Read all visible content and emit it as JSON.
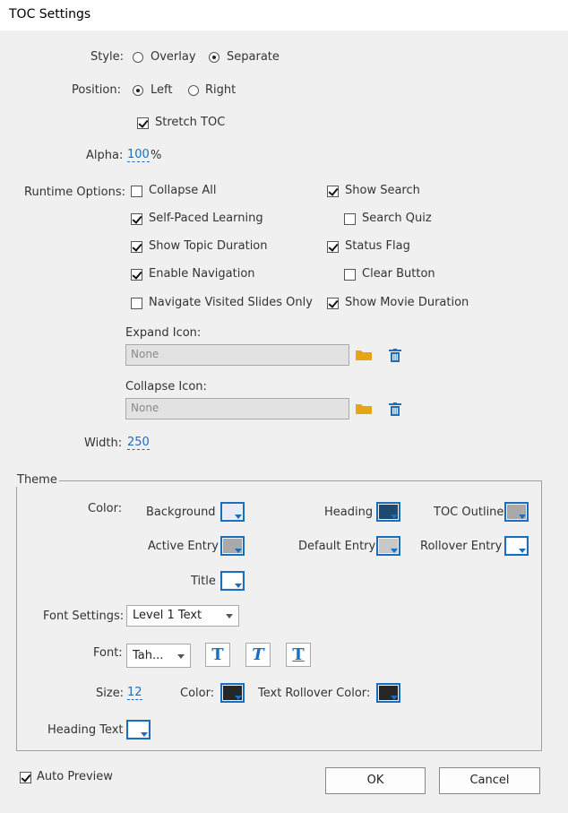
{
  "window": {
    "title": "TOC Settings"
  },
  "style": {
    "label": "Style:",
    "options": [
      "Overlay",
      "Separate"
    ],
    "selected": "Separate"
  },
  "position": {
    "label": "Position:",
    "options": [
      "Left",
      "Right"
    ],
    "selected": "Left"
  },
  "stretch_toc": {
    "label": "Stretch TOC",
    "checked": true
  },
  "alpha": {
    "label": "Alpha:",
    "value": "100",
    "unit": "%"
  },
  "runtime": {
    "label": "Runtime Options:",
    "left": [
      {
        "label": "Collapse All",
        "checked": false
      },
      {
        "label": "Self-Paced Learning",
        "checked": true
      },
      {
        "label": "Show Topic Duration",
        "checked": true
      },
      {
        "label": "Enable Navigation",
        "checked": true
      },
      {
        "label": "Navigate Visited Slides Only",
        "checked": false
      }
    ],
    "right": [
      {
        "label": "Show Search",
        "checked": true
      },
      {
        "label": "Search Quiz",
        "checked": false
      },
      {
        "label": "Status Flag",
        "checked": true
      },
      {
        "label": "Clear Button",
        "checked": false
      },
      {
        "label": "Show Movie Duration",
        "checked": true
      }
    ]
  },
  "expand_icon": {
    "label": "Expand Icon:",
    "placeholder": "None"
  },
  "collapse_icon": {
    "label": "Collapse Icon:",
    "placeholder": "None"
  },
  "width": {
    "label": "Width:",
    "value": "250"
  },
  "theme": {
    "title": "Theme",
    "color_label": "Color:",
    "swatches": [
      {
        "label": "Background",
        "color": "#e8ecf8"
      },
      {
        "label": "Heading",
        "color": "#1f4a70"
      },
      {
        "label": "TOC Outline",
        "color": "#a9a9a9"
      },
      {
        "label": "Active Entry",
        "color": "#a9a9a9"
      },
      {
        "label": "Default Entry",
        "color": "#c8c8c8"
      },
      {
        "label": "Rollover Entry",
        "color": "#ffffff"
      },
      {
        "label": "Title",
        "color": "#ffffff"
      }
    ],
    "font_settings_label": "Font Settings:",
    "font_settings_value": "Level 1 Text",
    "font_label": "Font:",
    "font_value": "Tah...",
    "style_buttons": [
      "T",
      "T",
      "T"
    ],
    "size_label": "Size:",
    "size_value": "12",
    "color2_label": "Color:",
    "color2": "#262626",
    "rollover_color_label": "Text Rollover Color:",
    "rollover_color": "#262626",
    "heading_text_label": "Heading Text",
    "heading_text_color": "#ffffff"
  },
  "auto_preview": {
    "label": "Auto Preview",
    "checked": true
  },
  "buttons": {
    "ok": "OK",
    "cancel": "Cancel"
  },
  "colors": {
    "accent": "#1a6ebd",
    "folder": "#e8a317",
    "field_bg": "#e2e2e2"
  }
}
